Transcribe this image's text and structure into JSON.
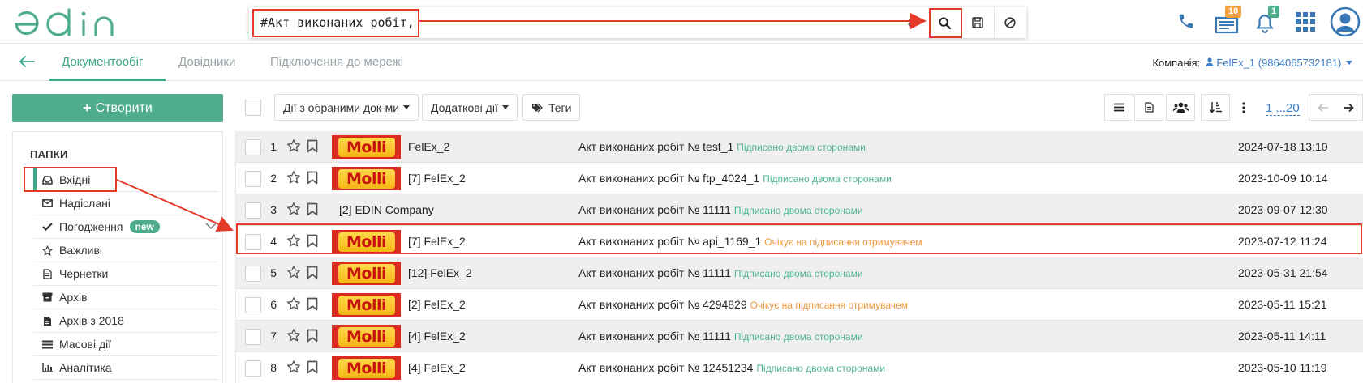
{
  "header": {
    "logo_text": "edin",
    "search": {
      "value": "#Акт виконаних робіт,",
      "placeholder": ""
    },
    "icons": [
      "phone-icon",
      "documents-icon",
      "bell-icon",
      "apps-grid-icon",
      "user-avatar-icon"
    ],
    "documents_badge": "10",
    "notifications_badge": "1"
  },
  "nav": {
    "tabs": [
      {
        "label": "Документообіг",
        "active": true
      },
      {
        "label": "Довідники",
        "active": false
      },
      {
        "label": "Підключення до мережі",
        "active": false
      }
    ],
    "company_label": "Компанія:",
    "company_value": "FelEx_1 (9864065732181)"
  },
  "sidebar": {
    "create_label": "Створити",
    "folders_title": "ПАПКИ",
    "items": [
      {
        "label": "Вхідні",
        "icon": "inbox-icon",
        "active": true
      },
      {
        "label": "Надіслані",
        "icon": "envelope-icon"
      },
      {
        "label": "Погодження",
        "icon": "check-icon",
        "badge": "new"
      },
      {
        "label": "Важливі",
        "icon": "star-icon"
      },
      {
        "label": "Чернетки",
        "icon": "draft-icon"
      },
      {
        "label": "Архів",
        "icon": "archive-icon"
      },
      {
        "label": "Архів з 2018",
        "icon": "archive-doc-icon"
      },
      {
        "label": "Масові дії",
        "icon": "list-icon"
      },
      {
        "label": "Аналітика",
        "icon": "chart-icon"
      }
    ]
  },
  "toolbar": {
    "selected_actions": "Дії з обраними док-ми",
    "extra_actions": "Додаткові дії",
    "tags": "Теги",
    "pager": "1 ...20"
  },
  "table": {
    "rows": [
      {
        "num": "1",
        "logo": "Molli",
        "sender": "FelEx_2",
        "doc": "Акт виконаних робіт № test_1",
        "status": "Підписано двома сторонами",
        "status_type": "green",
        "date": "2024-07-18 13:10"
      },
      {
        "num": "2",
        "logo": "Molli",
        "sender": "[7] FelEx_2",
        "doc": "Акт виконаних робіт № ftp_4024_1",
        "status": "Підписано двома сторонами",
        "status_type": "green",
        "date": "2023-10-09 10:14"
      },
      {
        "num": "3",
        "logo": "",
        "sender": "[2] EDIN Company",
        "doc": "Акт виконаних робіт № 11111",
        "status": "Підписано двома сторонами",
        "status_type": "green",
        "date": "2023-09-07 12:30"
      },
      {
        "num": "4",
        "logo": "Molli",
        "sender": "[7] FelEx_2",
        "doc": "Акт виконаних робіт № api_1169_1",
        "status": "Очікує на підписання отримувачем",
        "status_type": "orange",
        "date": "2023-07-12 11:24"
      },
      {
        "num": "5",
        "logo": "Molli",
        "sender": "[12] FelEx_2",
        "doc": "Акт виконаних робіт № 11111",
        "status": "Підписано двома сторонами",
        "status_type": "green",
        "date": "2023-05-31 21:54"
      },
      {
        "num": "6",
        "logo": "Molli",
        "sender": "[2] FelEx_2",
        "doc": "Акт виконаних робіт № 4294829",
        "status": "Очікує на підписання отримувачем",
        "status_type": "orange",
        "date": "2023-05-11 15:21"
      },
      {
        "num": "7",
        "logo": "Molli",
        "sender": "[4] FelEx_2",
        "doc": "Акт виконаних робіт № 11111",
        "status": "Підписано двома сторонами",
        "status_type": "green",
        "date": "2023-05-11 14:11"
      },
      {
        "num": "8",
        "logo": "Molli",
        "sender": "[4] FelEx_2",
        "doc": "Акт виконаних робіт № 12451234",
        "status": "Підписано двома сторонами",
        "status_type": "green",
        "date": "2023-05-10 11:19"
      }
    ]
  },
  "colors": {
    "brand": "#4fad8c",
    "accent_blue": "#3a7cc4",
    "status_green": "#4fb58e",
    "status_orange": "#f0963a",
    "annotation_red": "#e33a2a"
  }
}
